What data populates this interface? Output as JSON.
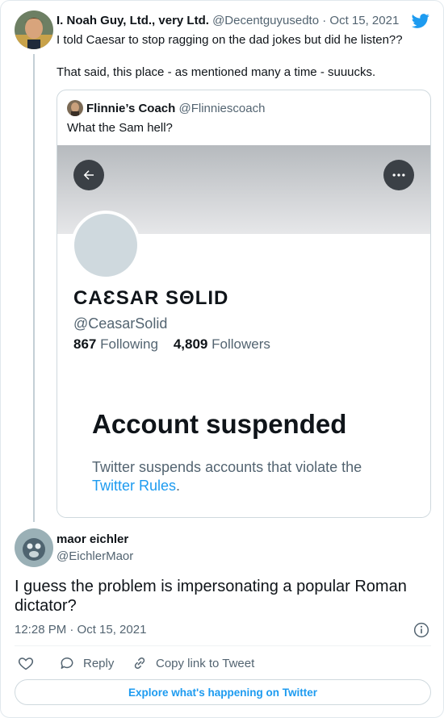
{
  "parent_tweet": {
    "author_name": "I. Noah Guy, Ltd., very Ltd.",
    "handle": "@Decentguyusedto",
    "separator": "·",
    "date": "Oct 15, 2021",
    "paragraphs": [
      "I told Caesar to stop ragging on the dad jokes but did he listen??",
      "That said, this place - as mentioned many a time - suuucks."
    ]
  },
  "quoted_tweet": {
    "author_name": "Flinnie’s Coach",
    "handle": "@Flinniescoach",
    "text": "What the Sam hell?",
    "image": {
      "profile_name": "CAƐSAR SΘLID",
      "profile_handle": "@CeasarSolid",
      "following_count": "867",
      "following_label": "Following",
      "followers_count": "4,809",
      "followers_label": "Followers",
      "suspended_title": "Account suspended",
      "suspended_text_before": "Twitter suspends accounts that violate the",
      "suspended_link": "Twitter Rules",
      "suspended_text_after": "."
    }
  },
  "reply_tweet": {
    "author_name": "maor eichler",
    "handle": "@EichlerMaor",
    "text": "I guess the problem is impersonating a popular Roman dictator?",
    "time": "12:28 PM · Oct 15, 2021",
    "actions": {
      "reply_label": "Reply",
      "copy_link_label": "Copy link to Tweet"
    }
  },
  "footer": {
    "explore_label": "Explore what's happening on Twitter"
  },
  "icons": {
    "brand": "twitter-bird-icon",
    "like": "heart-icon",
    "reply": "speech-bubble-icon",
    "copy_link": "link-icon",
    "info": "info-icon",
    "back": "arrow-left-icon",
    "more": "ellipsis-icon"
  },
  "colors": {
    "accent": "#1d9bf0",
    "text": "#0f1419",
    "secondary_text": "#536471",
    "border": "#cfd9de"
  }
}
